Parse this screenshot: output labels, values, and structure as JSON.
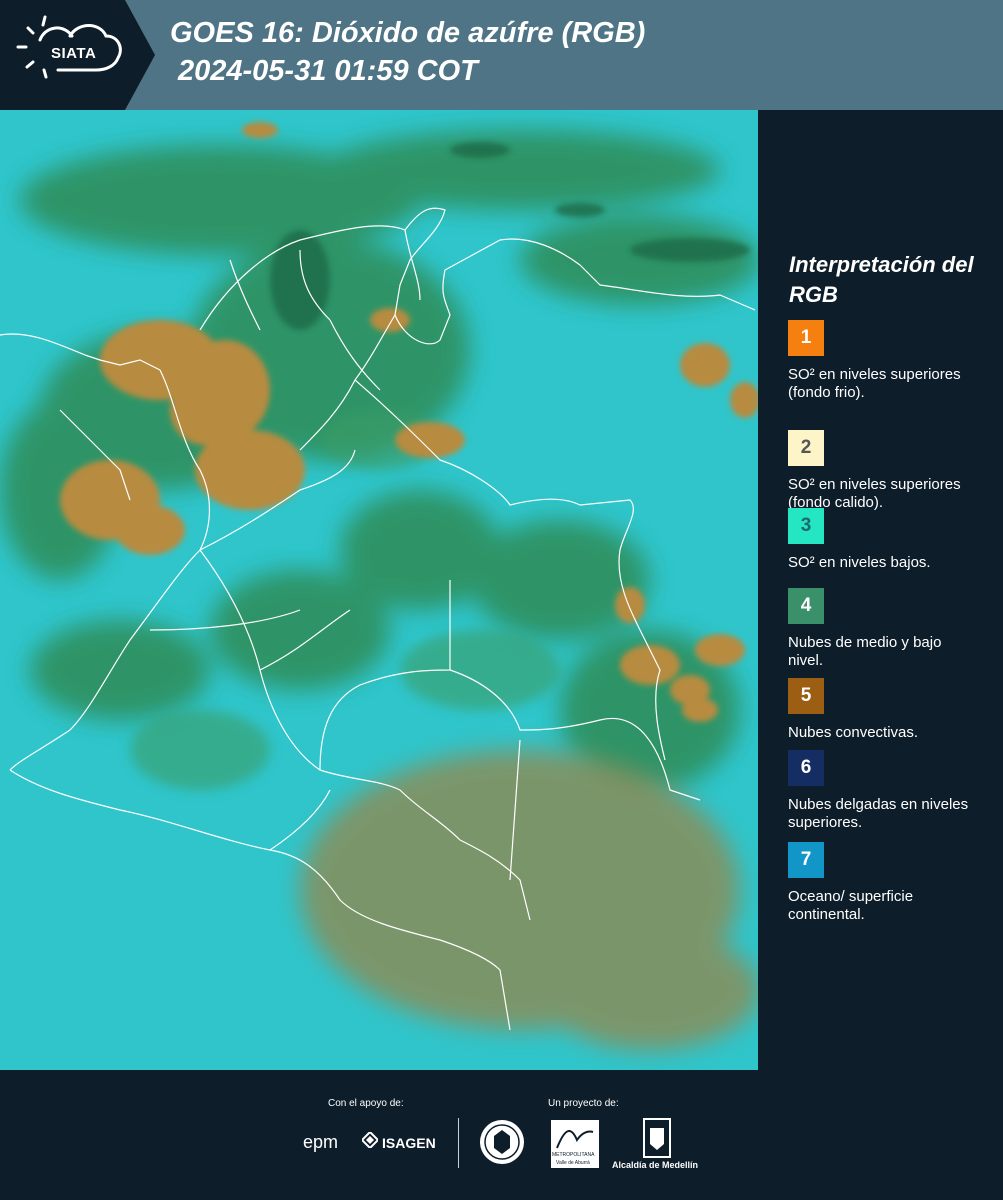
{
  "header": {
    "logo_text": "SIATA",
    "title_line1": "GOES 16: Dióxido de azúfre (RGB)",
    "title_line2": "2024-05-31 01:59 COT",
    "bg_color": "#4e7485",
    "logo_bg_color": "#0e1d2a"
  },
  "legend": {
    "title": "Interpretación del RGB",
    "items": [
      {
        "number": "1",
        "label": "SO² en niveles superiores (fondo frio).",
        "color": "#f5800f",
        "text_color": "#ffffff"
      },
      {
        "number": "2",
        "label": "SO² en niveles superiores (fondo calido).",
        "color": "#fdf5c7",
        "text_color": "#555555"
      },
      {
        "number": "3",
        "label": "SO² en niveles bajos.",
        "color": "#25e6c3",
        "text_color": "#1b6b6b"
      },
      {
        "number": "4",
        "label": "Nubes de medio y bajo nivel.",
        "color": "#3a9068",
        "text_color": "#ffffff"
      },
      {
        "number": "5",
        "label": "Nubes convectivas.",
        "color": "#9c5e12",
        "text_color": "#ffffff"
      },
      {
        "number": "6",
        "label": "Nubes delgadas en niveles superiores.",
        "color": "#142d63",
        "text_color": "#ffffff"
      },
      {
        "number": "7",
        "label": "Oceano/ superficie continental.",
        "color": "#1296c8",
        "text_color": "#ffffff"
      }
    ]
  },
  "footer": {
    "support_label": "Con el apoyo de:",
    "project_label": "Un proyecto de:",
    "sponsor1": "epm",
    "sponsor2": "ISAGEN",
    "partner1_line1": "METROPOLITANA",
    "partner1_line2": "Valle de Aburrá",
    "partner2": "Alcaldía de Medellín"
  },
  "map": {
    "ocean_color": "#2cc6cc",
    "land_cloud_color": "#2f8f5c",
    "convective_color": "#b58a3f",
    "border_color": "#ffffff"
  }
}
